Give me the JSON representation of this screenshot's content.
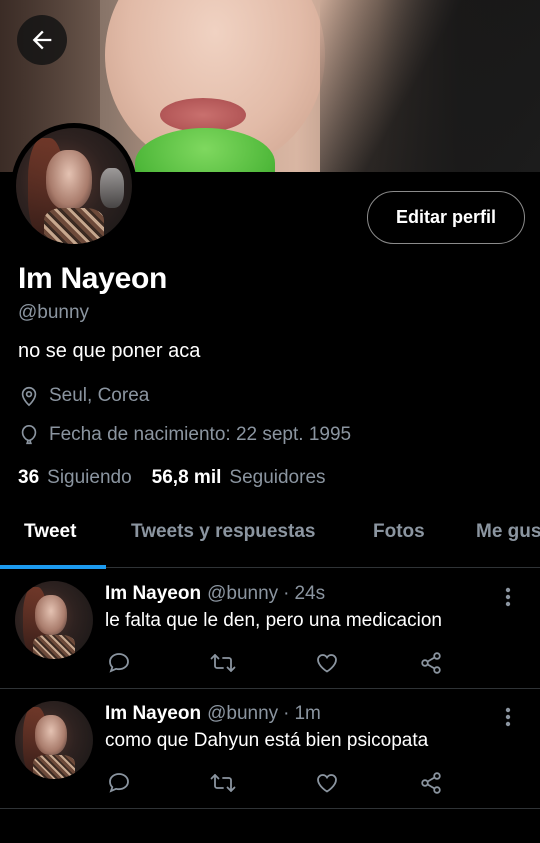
{
  "profile": {
    "display_name": "Im Nayeon",
    "handle": "@bunny",
    "bio": "no se que poner aca",
    "location": "Seul, Corea",
    "birthdate": "Fecha de nacimiento: 22 sept. 1995",
    "following_count": "36",
    "following_label": "Siguiendo",
    "followers_count": "56,8 mil",
    "followers_label": "Seguidores",
    "edit_button_label": "Editar perfil"
  },
  "tabs": [
    {
      "label": "Tweet",
      "active": true
    },
    {
      "label": "Tweets y respuestas",
      "active": false
    },
    {
      "label": "Fotos",
      "active": false
    },
    {
      "label": "Me gus",
      "active": false
    }
  ],
  "tweets": [
    {
      "name": "Im Nayeon",
      "handle": "@bunny",
      "separator": "·",
      "time": "24s",
      "text": "le falta que le den, pero una medicacion"
    },
    {
      "name": "Im Nayeon",
      "handle": "@bunny",
      "separator": "·",
      "time": "1m",
      "text": "como que Dahyun está bien psicopata"
    }
  ],
  "icons": {
    "back": "arrow-left-icon",
    "location": "map-pin-icon",
    "birth": "balloon-icon",
    "reply": "comment-icon",
    "retweet": "retweet-icon",
    "like": "heart-icon",
    "share": "share-icon",
    "more": "more-vertical-icon"
  },
  "colors": {
    "accent": "#1d9bf0",
    "secondary_text": "#8b95a0",
    "background": "#000000"
  }
}
